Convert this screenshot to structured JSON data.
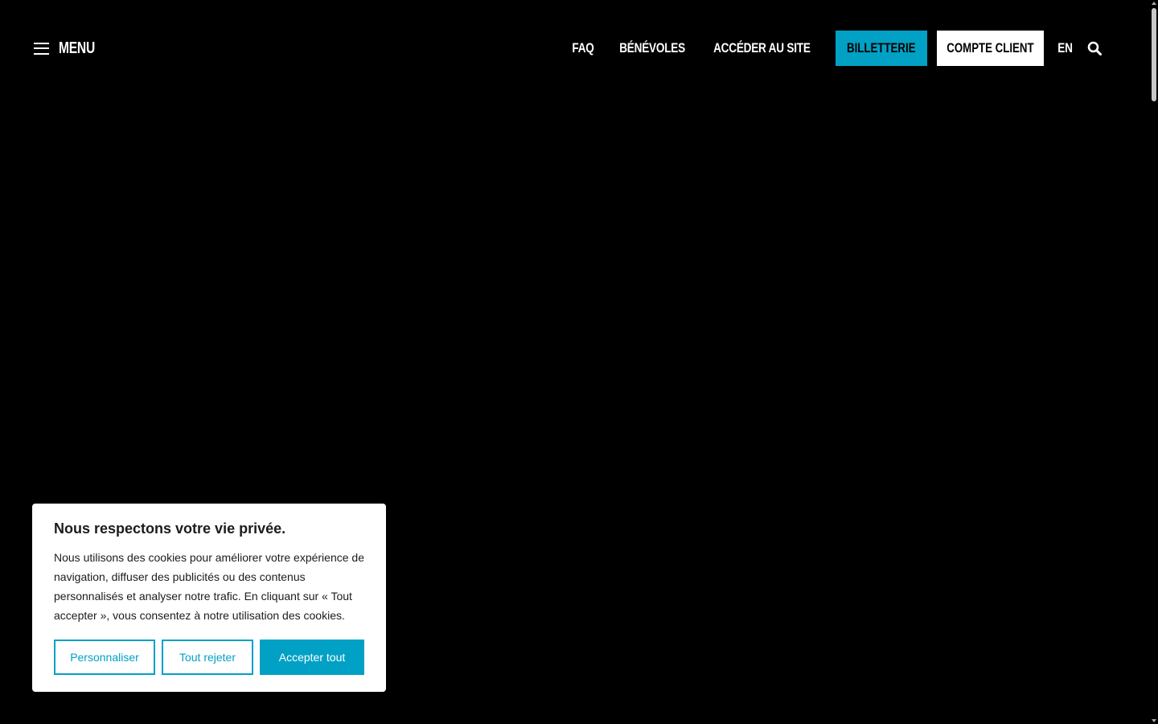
{
  "header": {
    "menu_label": "Menu",
    "nav": {
      "faq": "FAQ",
      "benevoles": "Bénévoles",
      "acceder": "Accéder au site",
      "billetterie": "Billetterie",
      "compte_client": "Compte client",
      "lang": "EN"
    },
    "search_icon": "search-icon"
  },
  "cookie_banner": {
    "title": "Nous respectons votre vie privée.",
    "body": "Nous utilisons des cookies pour améliorer votre expérience de navigation, diffuser des publicités ou des contenus personnalisés et analyser notre trafic. En cliquant sur « Tout accepter », vous consentez à notre utilisation des cookies.",
    "personnaliser": "Personnaliser",
    "tout_rejeter": "Tout rejeter",
    "accepter_tout": "Accepter tout"
  },
  "colors": {
    "accent": "#00a1c4",
    "background": "#000000"
  }
}
